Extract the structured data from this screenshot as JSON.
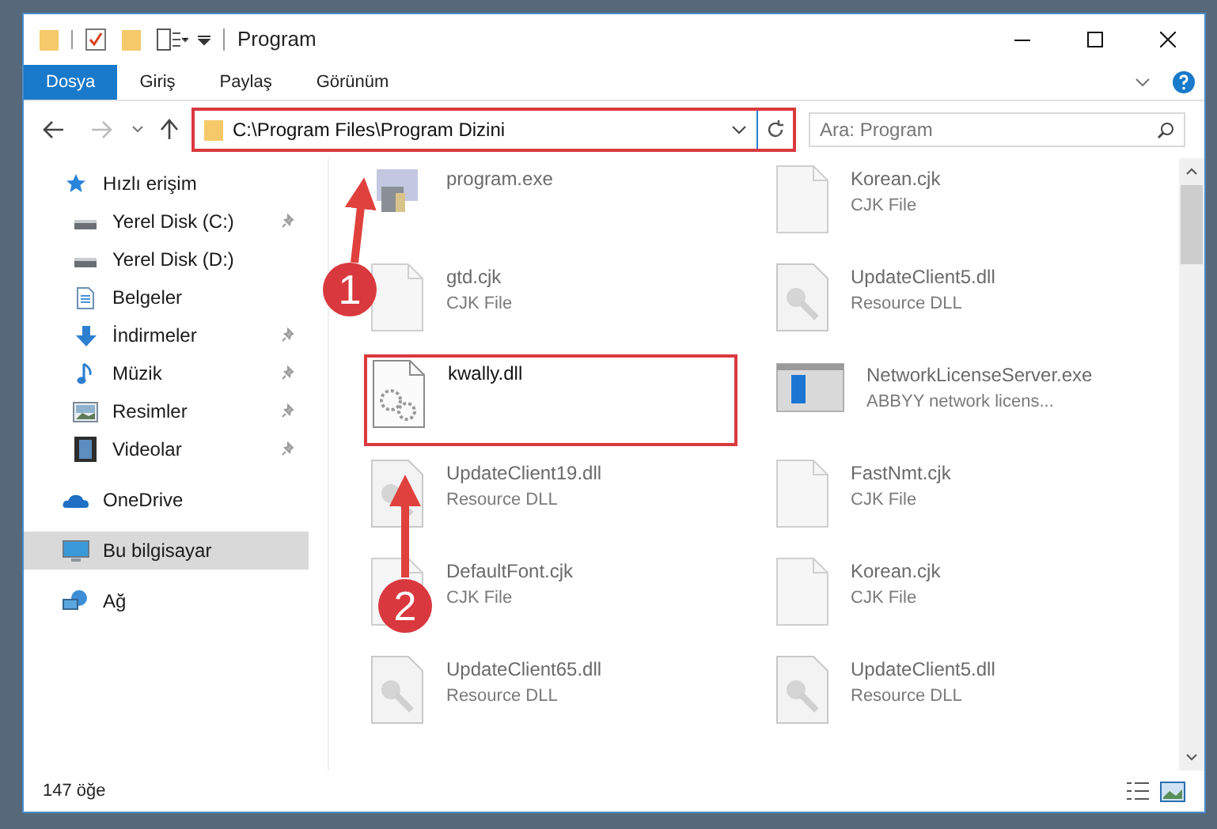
{
  "window": {
    "title": "Program"
  },
  "ribbon_tabs": [
    {
      "label": "Dosya",
      "selected": true
    },
    {
      "label": "Giriş",
      "selected": false
    },
    {
      "label": "Paylaş",
      "selected": false
    },
    {
      "label": "Görünüm",
      "selected": false
    }
  ],
  "address": {
    "path": "C:\\Program Files\\Program Dizini"
  },
  "search": {
    "placeholder": "Ara: Program"
  },
  "sidebar": {
    "items": [
      {
        "label": "Hızlı erişim",
        "kind": "star",
        "selected": false,
        "pinned": false,
        "children": [
          {
            "label": "Yerel Disk (C:)",
            "kind": "drive",
            "selected": false,
            "pinned": true
          },
          {
            "label": "Yerel Disk (D:)",
            "kind": "drive",
            "selected": false,
            "pinned": false
          },
          {
            "label": "Belgeler",
            "kind": "docs",
            "selected": false,
            "pinned": false
          },
          {
            "label": "İndirmeler",
            "kind": "download",
            "selected": false,
            "pinned": true
          },
          {
            "label": "Müzik",
            "kind": "music",
            "selected": false,
            "pinned": true
          },
          {
            "label": "Resimler",
            "kind": "pictures",
            "selected": false,
            "pinned": true
          },
          {
            "label": "Videolar",
            "kind": "video",
            "selected": false,
            "pinned": true
          }
        ]
      },
      {
        "label": "OneDrive",
        "kind": "cloud",
        "selected": false,
        "pinned": false
      },
      {
        "label": "Bu bilgisayar",
        "kind": "pc",
        "selected": true,
        "pinned": false
      },
      {
        "label": "Ağ",
        "kind": "network",
        "selected": false,
        "pinned": false
      }
    ]
  },
  "files": [
    {
      "name": "program.exe",
      "kind": "exe",
      "highlighted": false
    },
    {
      "name": "Korean.cjk",
      "type": "CJK File",
      "kind": "file",
      "highlighted": false
    },
    {
      "name": "gtd.cjk",
      "type": "CJK File",
      "kind": "file",
      "highlighted": false
    },
    {
      "name": "UpdateClient5.dll",
      "type": "Resource DLL",
      "kind": "dll",
      "highlighted": false
    },
    {
      "name": "kwally.dll",
      "kind": "gear",
      "highlighted": true
    },
    {
      "name": "NetworkLicenseServer.exe",
      "type": "ABBYY network licens...",
      "kind": "app",
      "highlighted": false
    },
    {
      "name": "UpdateClient19.dll",
      "type": "Resource DLL",
      "kind": "dll",
      "highlighted": false
    },
    {
      "name": "FastNmt.cjk",
      "type": "CJK File",
      "kind": "file",
      "highlighted": false
    },
    {
      "name": "DefaultFont.cjk",
      "type": "CJK File",
      "kind": "file",
      "highlighted": false
    },
    {
      "name": "Korean.cjk",
      "type": "CJK File",
      "kind": "file",
      "highlighted": false
    },
    {
      "name": "UpdateClient65.dll",
      "type": "Resource DLL",
      "kind": "dll",
      "highlighted": false
    },
    {
      "name": "UpdateClient5.dll",
      "type": "Resource DLL",
      "kind": "dll",
      "highlighted": false
    }
  ],
  "annotations": [
    {
      "label": "1"
    },
    {
      "label": "2"
    }
  ],
  "status_bar": {
    "count": "147 öğe"
  }
}
